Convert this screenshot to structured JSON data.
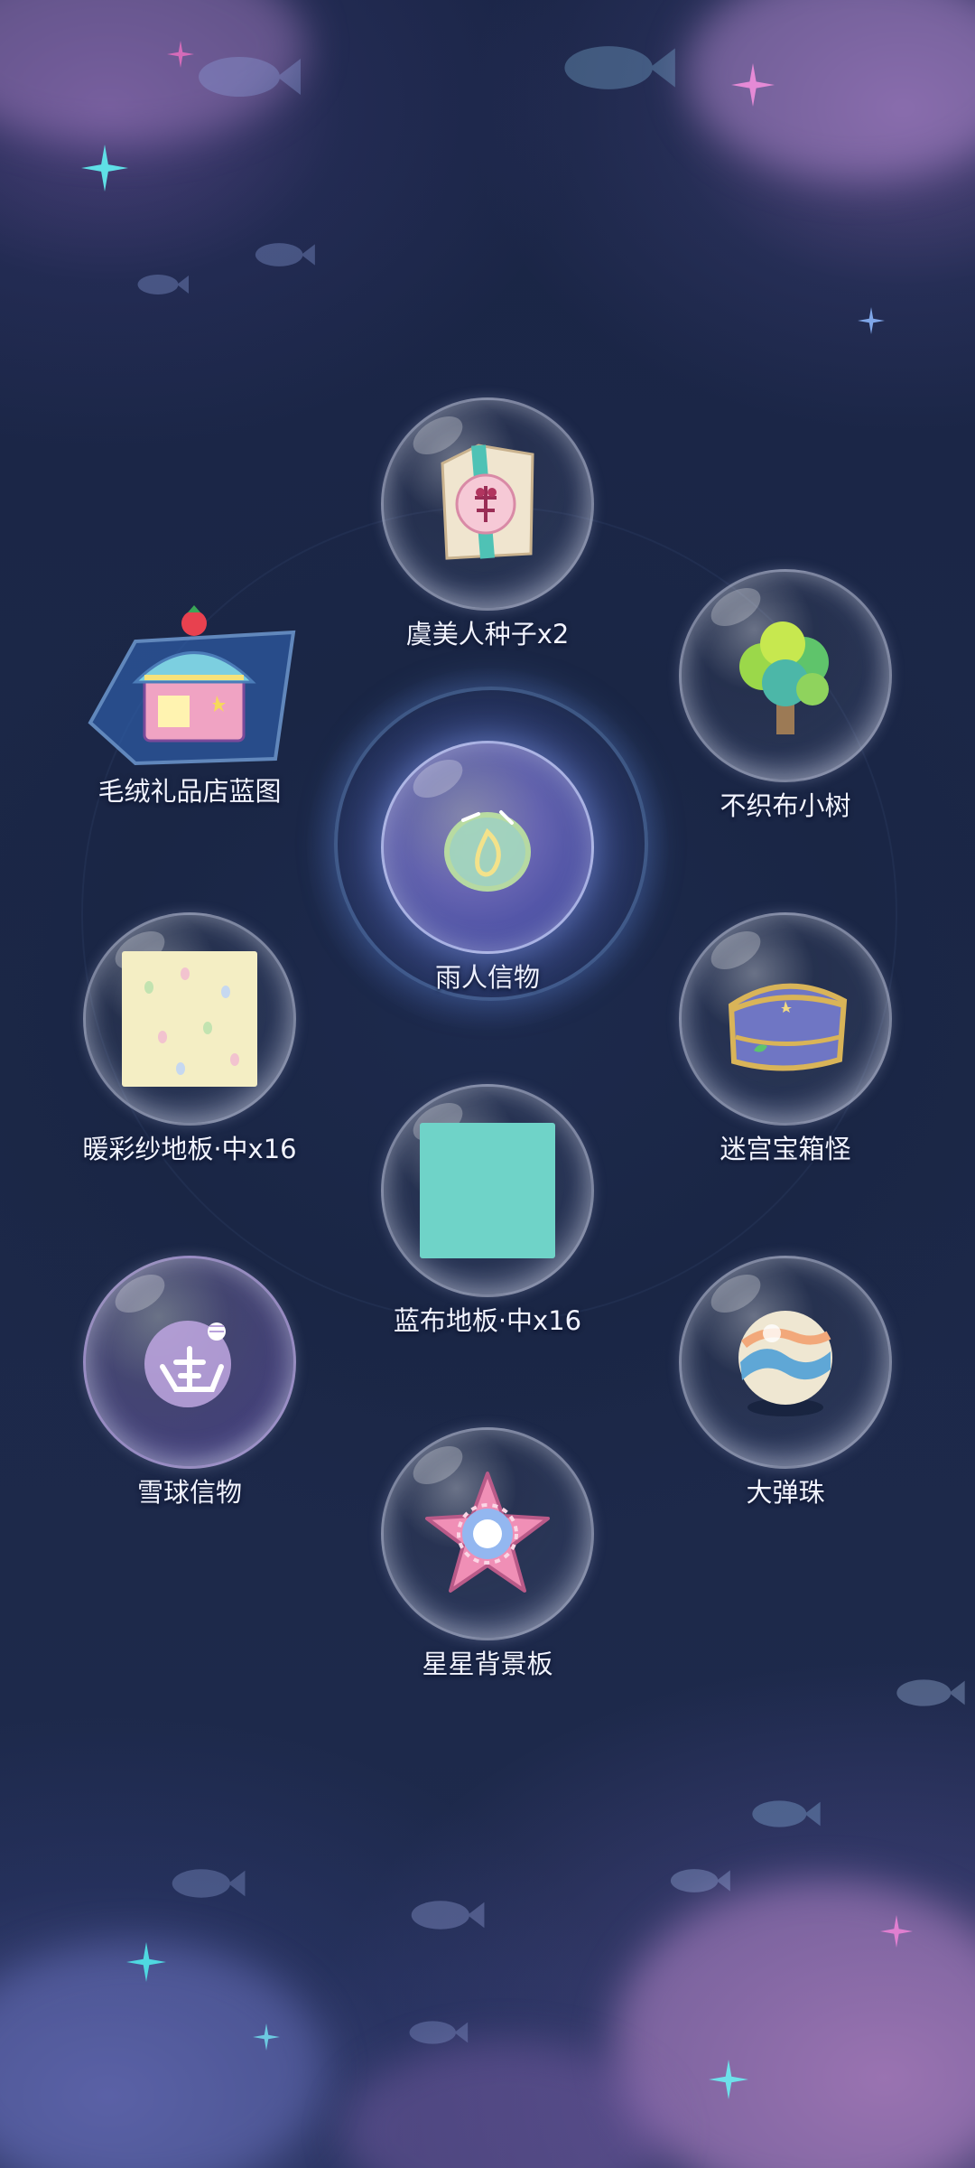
{
  "colors": {
    "background": "#1b2747",
    "label_text": "#f2f4ff",
    "bubble_border": "#e6ebff",
    "blue_floor": "#6fd3c8",
    "warm_floor": "#f4eec4"
  },
  "rewards": [
    {
      "id": "seed-packet",
      "label": "虞美人种子x2",
      "icon": "seed-packet-icon"
    },
    {
      "id": "shop-blueprint",
      "label": "毛绒礼品店蓝图",
      "icon": "shop-blueprint-icon"
    },
    {
      "id": "felt-tree",
      "label": "不织布小树",
      "icon": "felt-tree-icon"
    },
    {
      "id": "rain-token",
      "label": "雨人信物",
      "icon": "rain-token-icon"
    },
    {
      "id": "warm-floor",
      "label": "暖彩纱地板·中x16",
      "icon": "warm-floor-tile-icon"
    },
    {
      "id": "maze-chest",
      "label": "迷宫宝箱怪",
      "icon": "treasure-chest-icon"
    },
    {
      "id": "blue-floor",
      "label": "蓝布地板·中x16",
      "icon": "blue-floor-tile-icon"
    },
    {
      "id": "snowball-token",
      "label": "雪球信物",
      "icon": "snowball-token-icon"
    },
    {
      "id": "big-marble",
      "label": "大弹珠",
      "icon": "marble-icon"
    },
    {
      "id": "star-backdrop",
      "label": "星星背景板",
      "icon": "star-backdrop-icon"
    }
  ]
}
